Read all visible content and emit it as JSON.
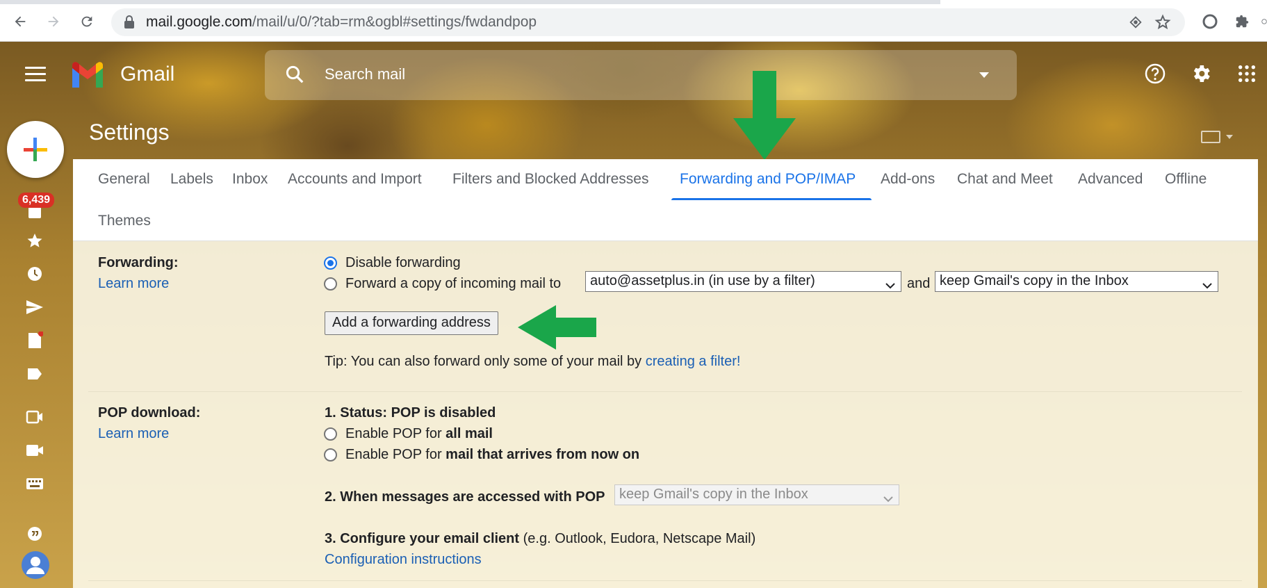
{
  "browser": {
    "url_host": "mail.google.com",
    "url_path": "/mail/u/0/?tab=rm&ogbl#settings/fwdandpop"
  },
  "header": {
    "app_name": "Gmail",
    "search_placeholder": "Search mail"
  },
  "sidebar": {
    "unread_count": "6,439"
  },
  "page": {
    "title": "Settings"
  },
  "tabs": [
    {
      "label": "General"
    },
    {
      "label": "Labels"
    },
    {
      "label": "Inbox"
    },
    {
      "label": "Accounts and Import"
    },
    {
      "label": "Filters and Blocked Addresses"
    },
    {
      "label": "Forwarding and POP/IMAP",
      "active": true
    },
    {
      "label": "Add-ons"
    },
    {
      "label": "Chat and Meet"
    },
    {
      "label": "Advanced"
    },
    {
      "label": "Offline"
    },
    {
      "label": "Themes"
    }
  ],
  "forwarding": {
    "label": "Forwarding:",
    "learn_more": "Learn more",
    "option_disable": "Disable forwarding",
    "option_forward": "Forward a copy of incoming mail to",
    "forward_address": "auto@assetplus.in (in use by a filter)",
    "and": "and",
    "copy_action": "keep Gmail's copy in the Inbox",
    "add_button": "Add a forwarding address",
    "tip_text": "Tip: You can also forward only some of your mail by",
    "tip_link": "creating a filter!"
  },
  "pop": {
    "label": "POP download:",
    "learn_more": "Learn more",
    "status": "1. Status: POP is disabled",
    "enable_all_prefix": "Enable POP for",
    "enable_all_bold": "all mail",
    "enable_now_prefix": "Enable POP for",
    "enable_now_bold": "mail that arrives from now on",
    "accessed_label": "2. When messages are accessed with POP",
    "accessed_value": "keep Gmail's copy in the Inbox",
    "configure_bold": "3. Configure your email client",
    "configure_rest": "(e.g. Outlook, Eudora, Netscape Mail)",
    "config_link": "Configuration instructions"
  },
  "colors": {
    "accent": "#1a73e8",
    "annotation_arrow": "#1aa64a",
    "badge": "#d93025"
  }
}
